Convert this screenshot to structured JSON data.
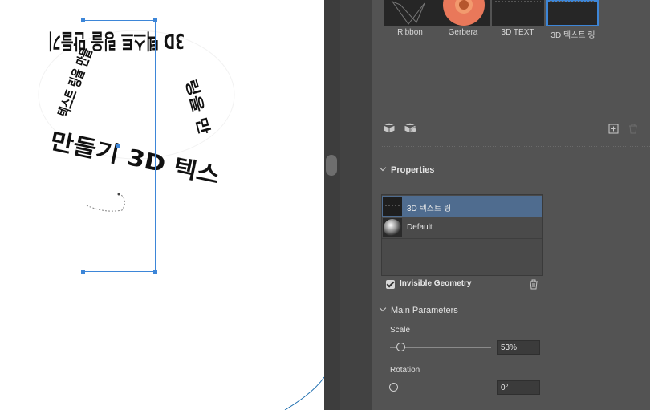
{
  "thumbnails": [
    {
      "label": "Ribbon"
    },
    {
      "label": "Gerbera"
    },
    {
      "label": "3D TEXT"
    },
    {
      "label": "3D 텍스트 링"
    }
  ],
  "canvas": {
    "ring_text_top": "3D 텍스트 링을 만들기",
    "ring_text_bottom": "만들기 3D 텍스",
    "ring_text_left": "텍스트 링을 만들",
    "ring_text_right": "링을 만"
  },
  "toolbar": {
    "icons": [
      "cube-icon",
      "cube-person-icon",
      "add-icon",
      "trash-icon"
    ]
  },
  "properties": {
    "header": "Properties",
    "materials": [
      {
        "name": "3D 텍스트 링",
        "selected": true
      },
      {
        "name": "Default",
        "selected": false
      }
    ],
    "invisible_geometry_label": "Invisible Geometry",
    "invisible_geometry_checked": true
  },
  "main_parameters": {
    "header": "Main Parameters",
    "scale": {
      "label": "Scale",
      "value": "53%",
      "level": 0.1
    },
    "rotation": {
      "label": "Rotation",
      "value": "0°",
      "level": 0
    }
  },
  "colors": {
    "selection": "#3d86d8",
    "selected_row": "#4f6c8f",
    "panel": "#535353"
  }
}
